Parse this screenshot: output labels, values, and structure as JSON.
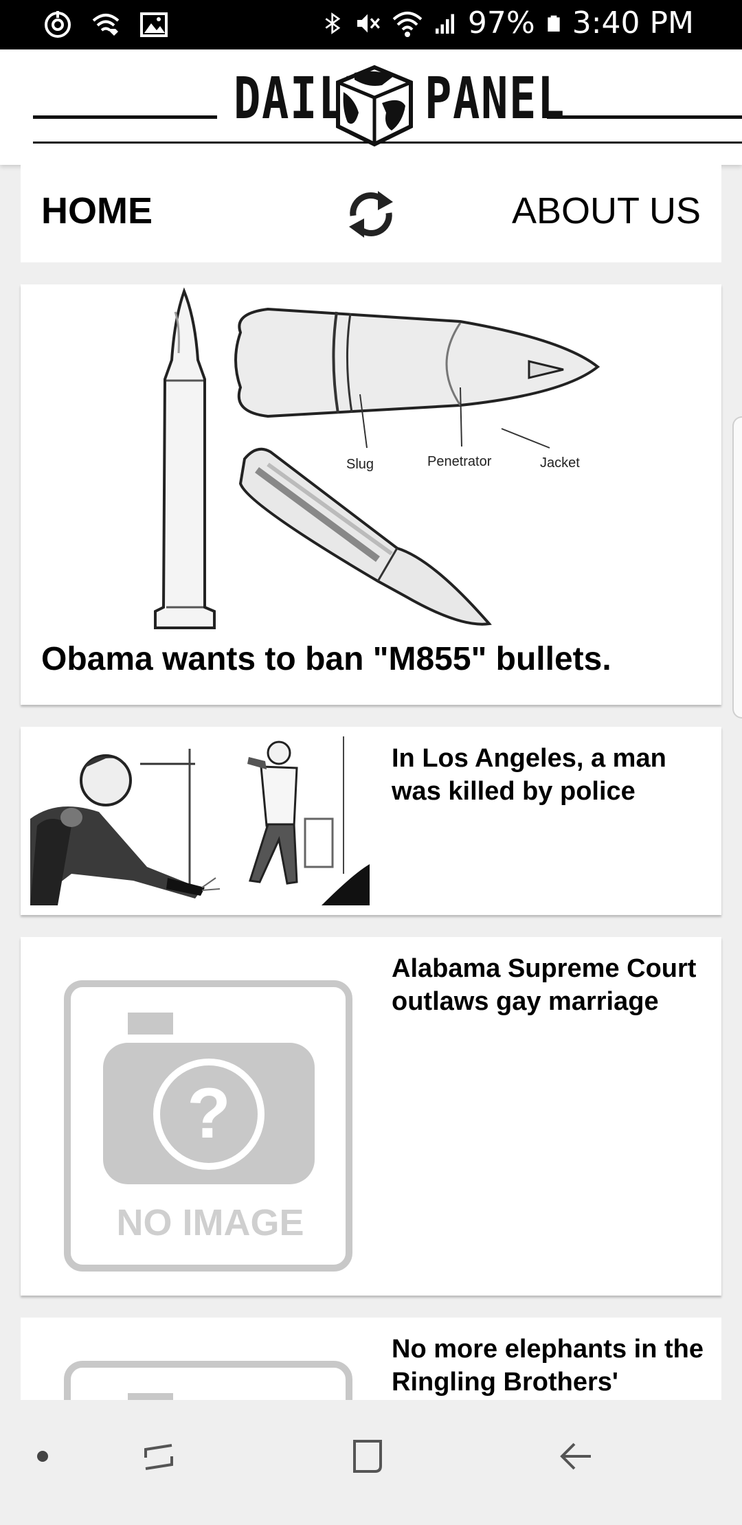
{
  "status_bar": {
    "battery": "97%",
    "time": "3:40 PM",
    "left_icons": [
      "sync-icon",
      "wifi-call-icon",
      "image-icon"
    ],
    "right_icons": [
      "bluetooth-icon",
      "mute-icon",
      "wifi-icon",
      "signal-icon",
      "battery-icon"
    ]
  },
  "header": {
    "logo_left": "DAILY",
    "logo_right": "PANEL"
  },
  "nav": {
    "home": "HOME",
    "about": "ABOUT US",
    "refresh_icon": "refresh-icon"
  },
  "featured": {
    "title": "Obama wants to ban \"M855\" bullets.",
    "image_labels": [
      "Slug",
      "Penetrator",
      "Jacket"
    ]
  },
  "articles": [
    {
      "title": "In Los Angeles, a man was killed by police"
    },
    {
      "title": "Alabama Supreme Court outlaws gay marriage",
      "image_placeholder": "NO IMAGE"
    },
    {
      "title": "No more elephants in the Ringling Brothers'"
    }
  ],
  "navigation_bar": {
    "icons": [
      "dot-icon",
      "recent-apps-icon",
      "home-icon",
      "back-icon"
    ]
  }
}
